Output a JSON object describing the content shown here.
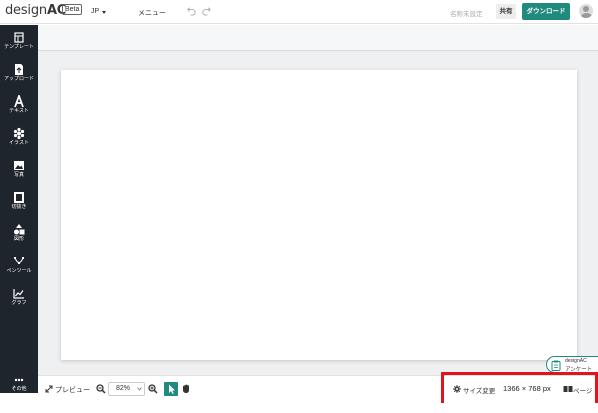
{
  "header": {
    "logo_text": "design",
    "logo_accent": "AC",
    "beta_badge": "Beta",
    "language": "JP",
    "menu_label": "メニュー",
    "doc_name": "名称未設定",
    "share_label": "共有",
    "download_label": "ダウンロード"
  },
  "sidebar": {
    "items": [
      {
        "label": "テンプレート",
        "icon": "template-icon"
      },
      {
        "label": "アップロード",
        "icon": "upload-icon"
      },
      {
        "label": "テキスト",
        "icon": "text-icon"
      },
      {
        "label": "イラスト",
        "icon": "illustration-icon"
      },
      {
        "label": "写真",
        "icon": "photo-icon"
      },
      {
        "label": "切抜き",
        "icon": "crop-icon"
      },
      {
        "label": "図形",
        "icon": "shapes-icon"
      },
      {
        "label": "ペンツール",
        "icon": "pen-tool-icon"
      },
      {
        "label": "グラフ",
        "icon": "graph-icon"
      }
    ],
    "more_label": "その他"
  },
  "survey": {
    "line1": "designAC",
    "line2": "アンケート"
  },
  "bottom": {
    "preview_label": "プレビュー",
    "zoom_value": "82%",
    "resize_label": "サイズ変更",
    "dimensions": "1366 × 768 px",
    "page_label": "ページ"
  },
  "colors": {
    "accent": "#1f8a7d",
    "sidebar_bg": "#1e252c",
    "highlight": "#e0151b"
  }
}
